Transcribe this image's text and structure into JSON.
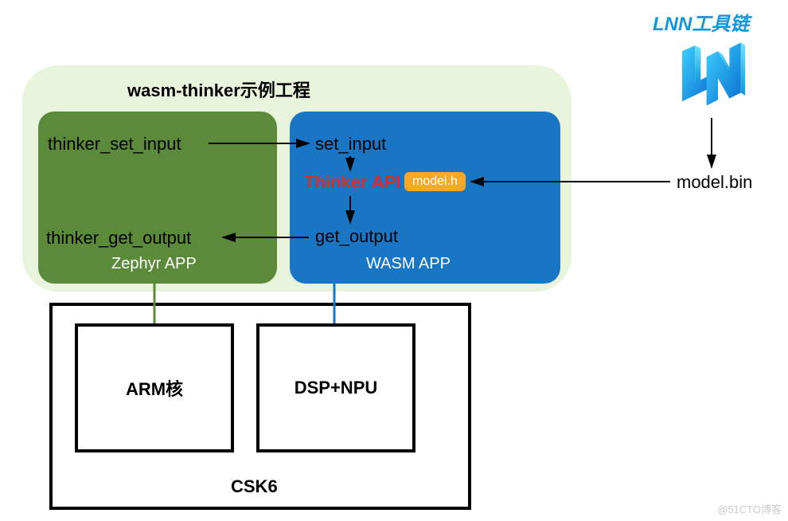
{
  "lnn_title": "LNN工具链",
  "project_title": "wasm-thinker示例工程",
  "zephyr": {
    "set_input": "thinker_set_input",
    "get_output": "thinker_get_output",
    "label": "Zephyr APP"
  },
  "wasm": {
    "set_input": "set_input",
    "api": "Thinker API",
    "model_h": "model.h",
    "get_output": "get_output",
    "label": "WASM APP"
  },
  "model_bin": "model.bin",
  "csk6": {
    "label": "CSK6",
    "arm": "ARM核",
    "dsp": "DSP+NPU"
  },
  "watermark": "@51CTO博客"
}
